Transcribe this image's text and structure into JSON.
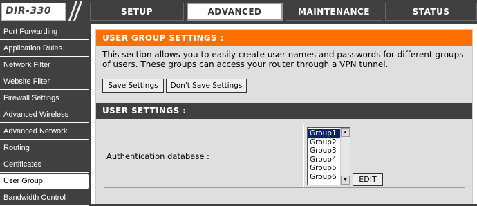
{
  "header": {
    "model": "DIR-330",
    "tabs": [
      {
        "label": "SETUP",
        "active": false
      },
      {
        "label": "ADVANCED",
        "active": true
      },
      {
        "label": "MAINTENANCE",
        "active": false
      },
      {
        "label": "STATUS",
        "active": false
      }
    ]
  },
  "sidebar": {
    "items": [
      {
        "label": "Port Forwarding",
        "active": false
      },
      {
        "label": "Application Rules",
        "active": false
      },
      {
        "label": "Network Filter",
        "active": false
      },
      {
        "label": "Website Filter",
        "active": false
      },
      {
        "label": "Firewall Settings",
        "active": false
      },
      {
        "label": "Advanced Wireless",
        "active": false
      },
      {
        "label": "Advanced Network",
        "active": false
      },
      {
        "label": "Routing",
        "active": false
      },
      {
        "label": "Certificates",
        "active": false
      },
      {
        "label": "User Group",
        "active": true
      },
      {
        "label": "Bandwidth Control",
        "active": false
      }
    ]
  },
  "user_group_settings": {
    "title": "USER GROUP SETTINGS :",
    "description": "This section allows you to easily create user names and passwords for different groups of users. These groups can access your router through a VPN tunnel.",
    "save_label": "Save Settings",
    "dont_save_label": "Don't Save Settings"
  },
  "user_settings": {
    "title": "USER SETTINGS :",
    "auth_label": "Authentication database :",
    "groups": [
      "Group1",
      "Group2",
      "Group3",
      "Group4",
      "Group5",
      "Group6"
    ],
    "selected_group": "Group1",
    "edit_label": "EDIT"
  },
  "colors": {
    "accent_orange": "#ff6f00",
    "dark_bar": "#404040",
    "panel_gray": "#dfdfdf",
    "selection_blue": "#0a246a"
  }
}
